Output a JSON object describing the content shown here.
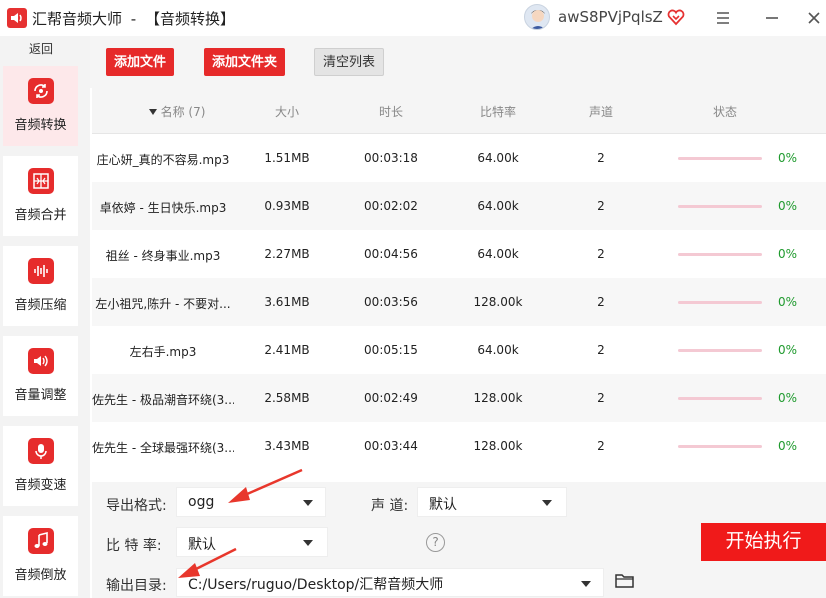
{
  "titlebar": {
    "app_name": "汇帮音频大师",
    "separator": "-",
    "page": "【音频转换】",
    "user_name": "awS8PVjPqlsZ",
    "icons": [
      "app-logo",
      "avatar",
      "vip-heart-icon",
      "menu-icon",
      "minimize-icon",
      "close-icon"
    ]
  },
  "sidebar": {
    "back_label": "返回",
    "items": [
      {
        "label": "音频转换",
        "icon": "convert-icon",
        "active": true
      },
      {
        "label": "音频合并",
        "icon": "merge-icon",
        "active": false
      },
      {
        "label": "音频压缩",
        "icon": "compress-icon",
        "active": false
      },
      {
        "label": "音量调整",
        "icon": "volume-icon",
        "active": false
      },
      {
        "label": "音频变速",
        "icon": "mic-icon",
        "active": false
      },
      {
        "label": "音频倒放",
        "icon": "music-note-icon",
        "active": false
      }
    ]
  },
  "toolbar": {
    "add_file": "添加文件",
    "add_folder": "添加文件夹",
    "clear_list": "清空列表"
  },
  "table": {
    "headers": {
      "name": "名称 (7)",
      "size": "大小",
      "duration": "时长",
      "bitrate": "比特率",
      "channels": "声道",
      "status": "状态"
    },
    "rows": [
      {
        "name": "庄心妍_真的不容易.mp3",
        "size": "1.51MB",
        "duration": "00:03:18",
        "bitrate": "64.00k",
        "channels": "2",
        "progress": "0%"
      },
      {
        "name": "卓依婷 - 生日快乐.mp3",
        "size": "0.93MB",
        "duration": "00:02:02",
        "bitrate": "64.00k",
        "channels": "2",
        "progress": "0%"
      },
      {
        "name": "祖丝 - 终身事业.mp3",
        "size": "2.27MB",
        "duration": "00:04:56",
        "bitrate": "64.00k",
        "channels": "2",
        "progress": "0%"
      },
      {
        "name": "左小祖咒,陈升 - 不要对...",
        "size": "3.61MB",
        "duration": "00:03:56",
        "bitrate": "128.00k",
        "channels": "2",
        "progress": "0%"
      },
      {
        "name": "左右手.mp3",
        "size": "2.41MB",
        "duration": "00:05:15",
        "bitrate": "64.00k",
        "channels": "2",
        "progress": "0%"
      },
      {
        "name": "佐先生 - 极品潮音环绕(3...",
        "size": "2.58MB",
        "duration": "00:02:49",
        "bitrate": "128.00k",
        "channels": "2",
        "progress": "0%"
      },
      {
        "name": "佐先生 - 全球最强环绕(3...",
        "size": "3.43MB",
        "duration": "00:03:44",
        "bitrate": "128.00k",
        "channels": "2",
        "progress": "0%"
      }
    ]
  },
  "settings": {
    "format_label": "导出格式:",
    "format_value": "ogg",
    "channel_label": "声 道:",
    "channel_value": "默认",
    "bitrate_label": "比 特 率:",
    "bitrate_value": "默认",
    "help_symbol": "?",
    "output_label": "输出目录:",
    "output_value": "C:/Users/ruguo/Desktop/汇帮音频大师",
    "start_button": "开始执行"
  },
  "colors": {
    "accent_red": "#e62a2a",
    "start_red": "#f01a1a",
    "progress_track": "#f4c9d3",
    "percent_green": "#1f9a2e",
    "annotation_arrow": "#e8372c"
  }
}
